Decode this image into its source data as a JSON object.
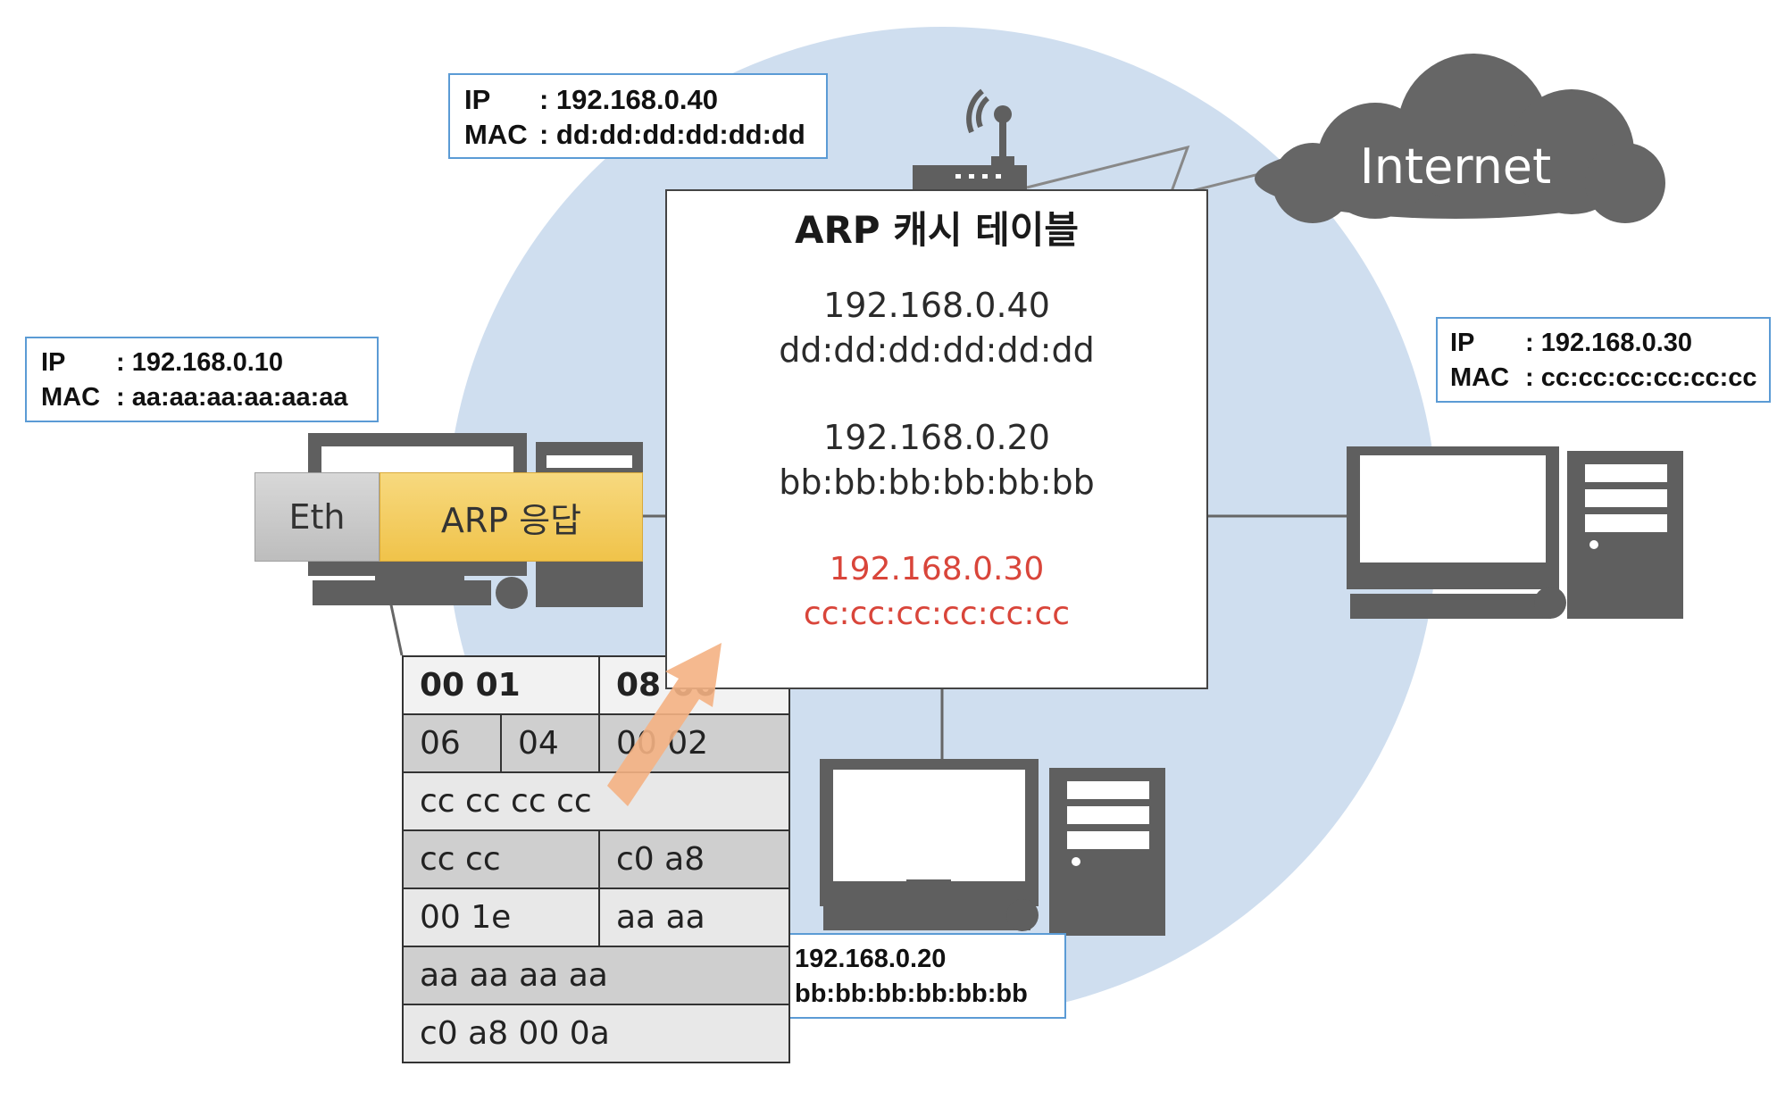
{
  "router": {
    "ip_label": "IP",
    "ip": ": 192.168.0.40",
    "mac_label": "MAC",
    "mac": ": dd:dd:dd:dd:dd:dd"
  },
  "host_a": {
    "ip_label": "IP",
    "ip": ": 192.168.0.10",
    "mac_label": "MAC",
    "mac": ": aa:aa:aa:aa:aa:aa"
  },
  "host_c": {
    "ip_label": "IP",
    "ip": ": 192.168.0.30",
    "mac_label": "MAC",
    "mac": ": cc:cc:cc:cc:cc:cc"
  },
  "host_b": {
    "ip": "192.168.0.20",
    "mac": "bb:bb:bb:bb:bb:bb"
  },
  "cloud": {
    "label": "Internet"
  },
  "frame": {
    "eth": "Eth",
    "arp": "ARP 응답"
  },
  "arp_table": {
    "title": "ARP 캐시 테이블",
    "entries": [
      {
        "ip": "192.168.0.40",
        "mac": "dd:dd:dd:dd:dd:dd",
        "highlight": false
      },
      {
        "ip": "192.168.0.20",
        "mac": "bb:bb:bb:bb:bb:bb",
        "highlight": false
      },
      {
        "ip": "192.168.0.30",
        "mac": "cc:cc:cc:cc:cc:cc",
        "highlight": true
      }
    ]
  },
  "packet": {
    "rows": [
      [
        "00   01",
        "08   00"
      ],
      [
        "06",
        "04",
        "00   02"
      ],
      [
        "cc   cc      cc   cc"
      ],
      [
        "cc   cc",
        "c0   a8"
      ],
      [
        "00   1e",
        "aa   aa"
      ],
      [
        "aa   aa      aa   aa"
      ],
      [
        "c0   a8   00   0a"
      ]
    ]
  },
  "colors": {
    "network_circle": "#cfdeef",
    "device": "#5f5f5f",
    "box_border": "#5b9bd5",
    "highlight": "#d9453a",
    "arrow": "#f4b183",
    "arp_label": "#f0c34a"
  }
}
